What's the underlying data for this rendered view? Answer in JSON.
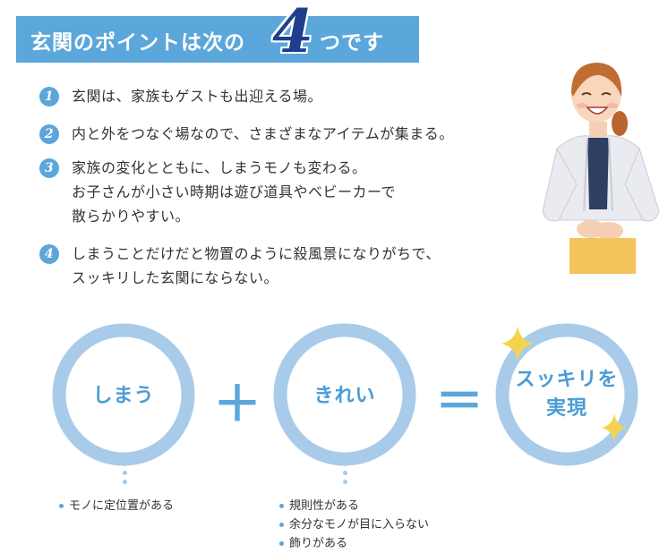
{
  "header": {
    "title_before": "玄関のポイントは次の",
    "number": "4",
    "title_after": "つです"
  },
  "points": [
    {
      "num": "1",
      "lines": [
        "玄関は、家族もゲストも出迎える場。"
      ]
    },
    {
      "num": "2",
      "lines": [
        "内と外をつなぐ場なので、さまざまなアイテムが集まる。"
      ]
    },
    {
      "num": "3",
      "lines": [
        "家族の変化とともに、しまうモノも変わる。",
        "お子さんが小さい時期は遊び道具やベビーカーで",
        "散らかりやすい。"
      ]
    },
    {
      "num": "4",
      "lines": [
        "しまうことだけだと物置のように殺風景になりがちで、",
        "スッキリした玄関にならない。"
      ]
    }
  ],
  "equation": {
    "term1": "しまう",
    "plus": "＋",
    "term2": "きれい",
    "equals": "＝",
    "result_line1": "スッキリを",
    "result_line2": "実現"
  },
  "notes": {
    "term1": [
      "モノに定位置がある"
    ],
    "term2": [
      "規則性がある",
      "余分なモノが目に入らない",
      "飾りがある"
    ]
  },
  "colors": {
    "accent": "#5ba6da",
    "number_navy": "#1f3f8c",
    "ring": "#a8cbe9",
    "sparkle": "#f5d34f"
  }
}
